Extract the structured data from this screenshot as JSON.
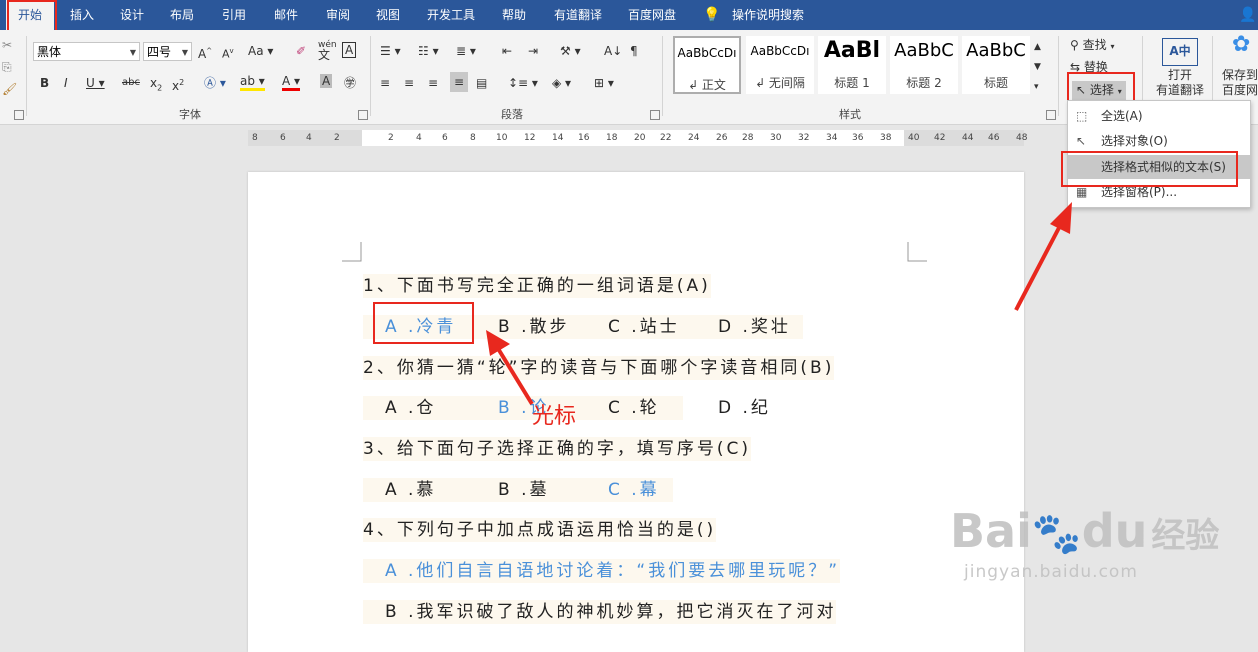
{
  "tabs": [
    "开始",
    "插入",
    "设计",
    "布局",
    "引用",
    "邮件",
    "审阅",
    "视图",
    "开发工具",
    "帮助",
    "有道翻译",
    "百度网盘"
  ],
  "tell_me": "操作说明搜索",
  "font": {
    "name": "黑体",
    "size": "四号",
    "group_label": "字体"
  },
  "paragraph": {
    "group_label": "段落"
  },
  "styles": {
    "group_label": "样式",
    "items": [
      {
        "preview": "AaBbCcDı",
        "name": "↲ 正文"
      },
      {
        "preview": "AaBbCcDı",
        "name": "↲ 无间隔"
      },
      {
        "preview": "AaBl",
        "name": "标题 1"
      },
      {
        "preview": "AaBbC",
        "name": "标题 2"
      },
      {
        "preview": "AaBbC",
        "name": "标题"
      }
    ]
  },
  "editing": {
    "find": "查找",
    "replace": "替换",
    "select": "选择"
  },
  "translate": {
    "line1": "打开",
    "line2": "有道翻译"
  },
  "save": {
    "line1": "保存到",
    "line2": "百度网"
  },
  "ruler_numbers": [
    "8",
    "6",
    "4",
    "2",
    "2",
    "4",
    "6",
    "8",
    "10",
    "12",
    "14",
    "16",
    "18",
    "20",
    "22",
    "24",
    "26",
    "28",
    "30",
    "32",
    "34",
    "36",
    "38",
    "40",
    "42",
    "44",
    "46",
    "48"
  ],
  "menu": {
    "items": [
      {
        "label": "全选(A)",
        "icon": "select-all-icon"
      },
      {
        "label": "选择对象(O)",
        "icon": "cursor-icon"
      },
      {
        "label": "选择格式相似的文本(S)",
        "icon": "none"
      },
      {
        "label": "选择窗格(P)...",
        "icon": "pane-icon"
      }
    ]
  },
  "document": {
    "lines": [
      {
        "t": "1、下面书写完全正确的一组词语是(A)"
      },
      {
        "parts": [
          "A .冷青",
          "B .散步",
          "C .站士",
          "D .奖壮"
        ]
      },
      {
        "t": "2、你猜一猜“轮”字的读音与下面哪个字读音相同(B)"
      },
      {
        "parts": [
          "A .仓",
          "B .论",
          "C .轮",
          "D .纪"
        ]
      },
      {
        "t": "3、给下面句子选择正确的字，填写序号(C)"
      },
      {
        "parts": [
          "A .慕",
          "B .墓",
          "C .幕"
        ]
      },
      {
        "t": "4、下列句子中加点成语运用恰当的是()"
      },
      {
        "t": "A .他们自言自语地讨论着：“我们要去哪里玩呢？”"
      },
      {
        "t": "B .我军识破了敌人的神机妙算，把它消灭在了河对"
      }
    ]
  },
  "annotation": "光标",
  "watermark": {
    "brand": "Bai",
    "brand2": "du",
    "jingyan": "经验",
    "url": "jingyan.baidu.com"
  },
  "colors": {
    "accent": "#2b579a",
    "red": "#e8281e",
    "blue_text": "#4a90d9"
  }
}
